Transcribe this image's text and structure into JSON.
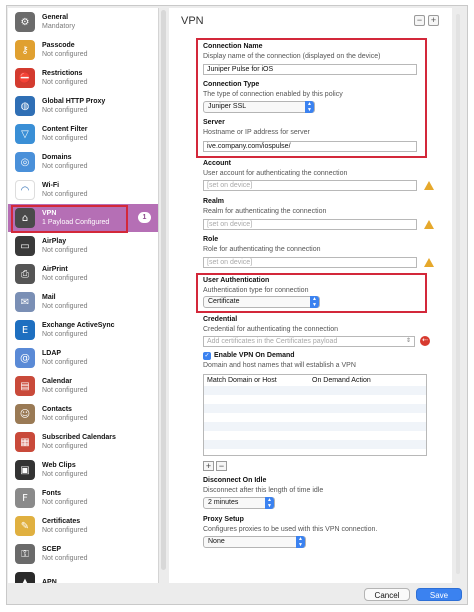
{
  "sidebar": {
    "items": [
      {
        "title": "General",
        "sub": "Mandatory",
        "icon": "gear-icon",
        "color": "#6b6b6b",
        "glyph": "⚙"
      },
      {
        "title": "Passcode",
        "sub": "Not configured",
        "icon": "key-icon",
        "color": "#e0a030",
        "glyph": "⚷"
      },
      {
        "title": "Restrictions",
        "sub": "Not configured",
        "icon": "restriction-icon",
        "color": "#d33b2f",
        "glyph": "⛔"
      },
      {
        "title": "Global HTTP Proxy",
        "sub": "Not configured",
        "icon": "globe-icon",
        "color": "#2f6fb5",
        "glyph": "◍"
      },
      {
        "title": "Content Filter",
        "sub": "Not configured",
        "icon": "filter-icon",
        "color": "#3a8fd6",
        "glyph": "▽"
      },
      {
        "title": "Domains",
        "sub": "Not configured",
        "icon": "domains-icon",
        "color": "#4a90d9",
        "glyph": "◎"
      },
      {
        "title": "Wi-Fi",
        "sub": "Not configured",
        "icon": "wifi-icon",
        "color": "#ffffff",
        "glyph": "◠"
      },
      {
        "title": "VPN",
        "sub": "1 Payload Configured",
        "icon": "vpn-icon",
        "color": "#4a4a4a",
        "glyph": "⌂",
        "badge": "1"
      },
      {
        "title": "AirPlay",
        "sub": "Not configured",
        "icon": "airplay-icon",
        "color": "#3a3a3a",
        "glyph": "▭"
      },
      {
        "title": "AirPrint",
        "sub": "Not configured",
        "icon": "printer-icon",
        "color": "#555555",
        "glyph": "⎙"
      },
      {
        "title": "Mail",
        "sub": "Not configured",
        "icon": "mail-icon",
        "color": "#7a8fb5",
        "glyph": "✉"
      },
      {
        "title": "Exchange ActiveSync",
        "sub": "Not configured",
        "icon": "exchange-icon",
        "color": "#1e6fc0",
        "glyph": "E"
      },
      {
        "title": "LDAP",
        "sub": "Not configured",
        "icon": "ldap-icon",
        "color": "#5a8ad6",
        "glyph": "@"
      },
      {
        "title": "Calendar",
        "sub": "Not configured",
        "icon": "calendar-icon",
        "color": "#c94a3a",
        "glyph": "▤"
      },
      {
        "title": "Contacts",
        "sub": "Not configured",
        "icon": "contacts-icon",
        "color": "#9a7a55",
        "glyph": "☺"
      },
      {
        "title": "Subscribed Calendars",
        "sub": "Not configured",
        "icon": "subscribed-calendar-icon",
        "color": "#c94a3a",
        "glyph": "▦"
      },
      {
        "title": "Web Clips",
        "sub": "Not configured",
        "icon": "webclip-icon",
        "color": "#333333",
        "glyph": "▣"
      },
      {
        "title": "Fonts",
        "sub": "Not configured",
        "icon": "fonts-icon",
        "color": "#8a8a8a",
        "glyph": "F"
      },
      {
        "title": "Certificates",
        "sub": "Not configured",
        "icon": "certificate-icon",
        "color": "#e0b040",
        "glyph": "✎"
      },
      {
        "title": "SCEP",
        "sub": "Not configured",
        "icon": "scep-icon",
        "color": "#6a6a6a",
        "glyph": "⚿"
      },
      {
        "title": "APN",
        "sub": "",
        "icon": "apn-icon",
        "color": "#2a2a2a",
        "glyph": "▲"
      }
    ]
  },
  "main": {
    "title": "VPN",
    "remove_label": "−",
    "add_label": "+",
    "connection_name": {
      "label": "Connection Name",
      "desc": "Display name of the connection (displayed on the device)",
      "value": "Juniper Pulse for iOS"
    },
    "connection_type": {
      "label": "Connection Type",
      "desc": "The type of connection enabled by this policy",
      "value": "Juniper SSL"
    },
    "server": {
      "label": "Server",
      "desc": "Hostname or IP address for server",
      "value": "ive.company.com/iospulse/"
    },
    "account": {
      "label": "Account",
      "desc": "User account for authenticating the connection",
      "placeholder": "[set on device]"
    },
    "realm": {
      "label": "Realm",
      "desc": "Realm for authenticating the connection",
      "placeholder": "[set on device]"
    },
    "role": {
      "label": "Role",
      "desc": "Role for authenticating the connection",
      "placeholder": "[set on device]"
    },
    "user_auth": {
      "label": "User Authentication",
      "desc": "Authentication type for connection",
      "value": "Certificate"
    },
    "credential": {
      "label": "Credential",
      "desc": "Credential for authenticating the connection",
      "value": "Add certificates in the Certificates payload"
    },
    "on_demand": {
      "label": "Enable VPN On Demand",
      "desc": "Domain and host names that will establish a VPN",
      "col1": "Match Domain or Host",
      "col2": "On Demand Action"
    },
    "table_add": "+",
    "table_remove": "−",
    "idle": {
      "label": "Disconnect On Idle",
      "desc": "Disconnect after this length of time idle",
      "value": "2 minutes"
    },
    "proxy": {
      "label": "Proxy Setup",
      "desc": "Configures proxies to be used with this VPN connection.",
      "value": "None"
    }
  },
  "footer": {
    "cancel": "Cancel",
    "save": "Save"
  },
  "colors": {
    "selected": "#b56fb5",
    "highlight": "#d3283a",
    "accent": "#3b82f0"
  }
}
